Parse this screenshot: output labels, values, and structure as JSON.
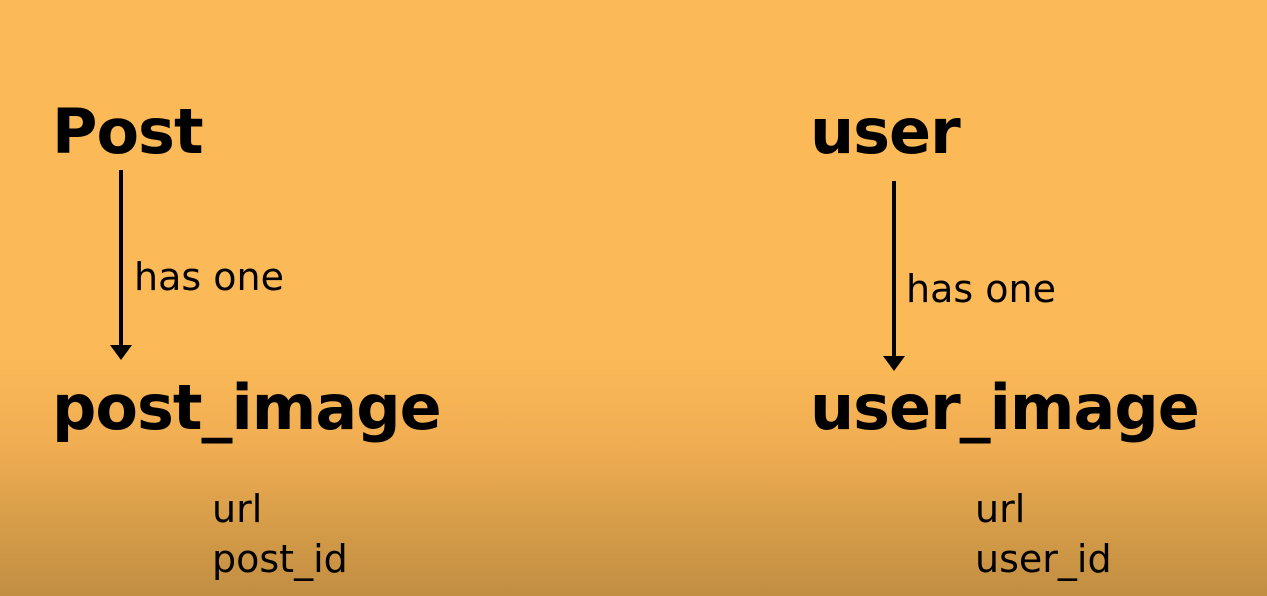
{
  "background_color": "#fbb957",
  "left": {
    "parent": "Post",
    "relation": "has one",
    "child": "post_image",
    "fields": [
      "url",
      "post_id"
    ]
  },
  "right": {
    "parent": "user",
    "relation": "has one",
    "child": "user_image",
    "fields": [
      "url",
      "user_id"
    ]
  }
}
